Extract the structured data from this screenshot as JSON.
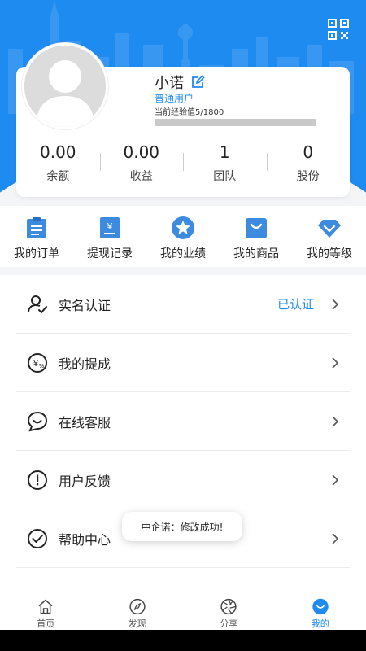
{
  "colors": {
    "accent": "#1e8bf0",
    "header_bg": "#1e8bf0",
    "page_bg": "#f4f5f7"
  },
  "profile": {
    "username": "小诺",
    "level": "普通用户",
    "experience_text": "当前经验值5/1800",
    "experience_progress": 0.003
  },
  "stats": [
    {
      "value": "0.00",
      "label": "余额"
    },
    {
      "value": "0.00",
      "label": "收益"
    },
    {
      "value": "1",
      "label": "团队"
    },
    {
      "value": "0",
      "label": "股份"
    }
  ],
  "quick_nav": [
    {
      "label": "我的订单",
      "icon": "order-icon"
    },
    {
      "label": "提现记录",
      "icon": "withdraw-icon"
    },
    {
      "label": "我的业绩",
      "icon": "star-badge-icon"
    },
    {
      "label": "我的商品",
      "icon": "shopping-bag-icon"
    },
    {
      "label": "我的等级",
      "icon": "diamond-icon"
    }
  ],
  "menu": [
    {
      "label": "实名认证",
      "icon": "user-verify-icon",
      "status": "已认证"
    },
    {
      "label": "我的提成",
      "icon": "commission-icon",
      "status": ""
    },
    {
      "label": "在线客服",
      "icon": "chat-icon",
      "status": ""
    },
    {
      "label": "用户反馈",
      "icon": "feedback-icon",
      "status": ""
    },
    {
      "label": "帮助中心",
      "icon": "help-icon",
      "status": ""
    }
  ],
  "toast": {
    "text": "中企诺：修改成功!"
  },
  "tabbar": [
    {
      "label": "首页",
      "icon": "home-icon",
      "active": false
    },
    {
      "label": "发现",
      "icon": "compass-icon",
      "active": false
    },
    {
      "label": "分享",
      "icon": "aperture-icon",
      "active": false
    },
    {
      "label": "我的",
      "icon": "profile-icon",
      "active": true
    }
  ]
}
